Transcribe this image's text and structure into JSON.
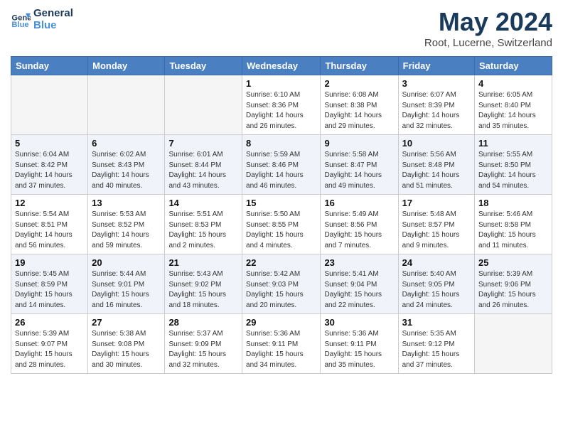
{
  "header": {
    "logo_line1": "General",
    "logo_line2": "Blue",
    "month_title": "May 2024",
    "location": "Root, Lucerne, Switzerland"
  },
  "weekdays": [
    "Sunday",
    "Monday",
    "Tuesday",
    "Wednesday",
    "Thursday",
    "Friday",
    "Saturday"
  ],
  "weeks": [
    [
      {
        "day": "",
        "info": ""
      },
      {
        "day": "",
        "info": ""
      },
      {
        "day": "",
        "info": ""
      },
      {
        "day": "1",
        "info": "Sunrise: 6:10 AM\nSunset: 8:36 PM\nDaylight: 14 hours and 26 minutes."
      },
      {
        "day": "2",
        "info": "Sunrise: 6:08 AM\nSunset: 8:38 PM\nDaylight: 14 hours and 29 minutes."
      },
      {
        "day": "3",
        "info": "Sunrise: 6:07 AM\nSunset: 8:39 PM\nDaylight: 14 hours and 32 minutes."
      },
      {
        "day": "4",
        "info": "Sunrise: 6:05 AM\nSunset: 8:40 PM\nDaylight: 14 hours and 35 minutes."
      }
    ],
    [
      {
        "day": "5",
        "info": "Sunrise: 6:04 AM\nSunset: 8:42 PM\nDaylight: 14 hours and 37 minutes."
      },
      {
        "day": "6",
        "info": "Sunrise: 6:02 AM\nSunset: 8:43 PM\nDaylight: 14 hours and 40 minutes."
      },
      {
        "day": "7",
        "info": "Sunrise: 6:01 AM\nSunset: 8:44 PM\nDaylight: 14 hours and 43 minutes."
      },
      {
        "day": "8",
        "info": "Sunrise: 5:59 AM\nSunset: 8:46 PM\nDaylight: 14 hours and 46 minutes."
      },
      {
        "day": "9",
        "info": "Sunrise: 5:58 AM\nSunset: 8:47 PM\nDaylight: 14 hours and 49 minutes."
      },
      {
        "day": "10",
        "info": "Sunrise: 5:56 AM\nSunset: 8:48 PM\nDaylight: 14 hours and 51 minutes."
      },
      {
        "day": "11",
        "info": "Sunrise: 5:55 AM\nSunset: 8:50 PM\nDaylight: 14 hours and 54 minutes."
      }
    ],
    [
      {
        "day": "12",
        "info": "Sunrise: 5:54 AM\nSunset: 8:51 PM\nDaylight: 14 hours and 56 minutes."
      },
      {
        "day": "13",
        "info": "Sunrise: 5:53 AM\nSunset: 8:52 PM\nDaylight: 14 hours and 59 minutes."
      },
      {
        "day": "14",
        "info": "Sunrise: 5:51 AM\nSunset: 8:53 PM\nDaylight: 15 hours and 2 minutes."
      },
      {
        "day": "15",
        "info": "Sunrise: 5:50 AM\nSunset: 8:55 PM\nDaylight: 15 hours and 4 minutes."
      },
      {
        "day": "16",
        "info": "Sunrise: 5:49 AM\nSunset: 8:56 PM\nDaylight: 15 hours and 7 minutes."
      },
      {
        "day": "17",
        "info": "Sunrise: 5:48 AM\nSunset: 8:57 PM\nDaylight: 15 hours and 9 minutes."
      },
      {
        "day": "18",
        "info": "Sunrise: 5:46 AM\nSunset: 8:58 PM\nDaylight: 15 hours and 11 minutes."
      }
    ],
    [
      {
        "day": "19",
        "info": "Sunrise: 5:45 AM\nSunset: 8:59 PM\nDaylight: 15 hours and 14 minutes."
      },
      {
        "day": "20",
        "info": "Sunrise: 5:44 AM\nSunset: 9:01 PM\nDaylight: 15 hours and 16 minutes."
      },
      {
        "day": "21",
        "info": "Sunrise: 5:43 AM\nSunset: 9:02 PM\nDaylight: 15 hours and 18 minutes."
      },
      {
        "day": "22",
        "info": "Sunrise: 5:42 AM\nSunset: 9:03 PM\nDaylight: 15 hours and 20 minutes."
      },
      {
        "day": "23",
        "info": "Sunrise: 5:41 AM\nSunset: 9:04 PM\nDaylight: 15 hours and 22 minutes."
      },
      {
        "day": "24",
        "info": "Sunrise: 5:40 AM\nSunset: 9:05 PM\nDaylight: 15 hours and 24 minutes."
      },
      {
        "day": "25",
        "info": "Sunrise: 5:39 AM\nSunset: 9:06 PM\nDaylight: 15 hours and 26 minutes."
      }
    ],
    [
      {
        "day": "26",
        "info": "Sunrise: 5:39 AM\nSunset: 9:07 PM\nDaylight: 15 hours and 28 minutes."
      },
      {
        "day": "27",
        "info": "Sunrise: 5:38 AM\nSunset: 9:08 PM\nDaylight: 15 hours and 30 minutes."
      },
      {
        "day": "28",
        "info": "Sunrise: 5:37 AM\nSunset: 9:09 PM\nDaylight: 15 hours and 32 minutes."
      },
      {
        "day": "29",
        "info": "Sunrise: 5:36 AM\nSunset: 9:11 PM\nDaylight: 15 hours and 34 minutes."
      },
      {
        "day": "30",
        "info": "Sunrise: 5:36 AM\nSunset: 9:11 PM\nDaylight: 15 hours and 35 minutes."
      },
      {
        "day": "31",
        "info": "Sunrise: 5:35 AM\nSunset: 9:12 PM\nDaylight: 15 hours and 37 minutes."
      },
      {
        "day": "",
        "info": ""
      }
    ]
  ]
}
